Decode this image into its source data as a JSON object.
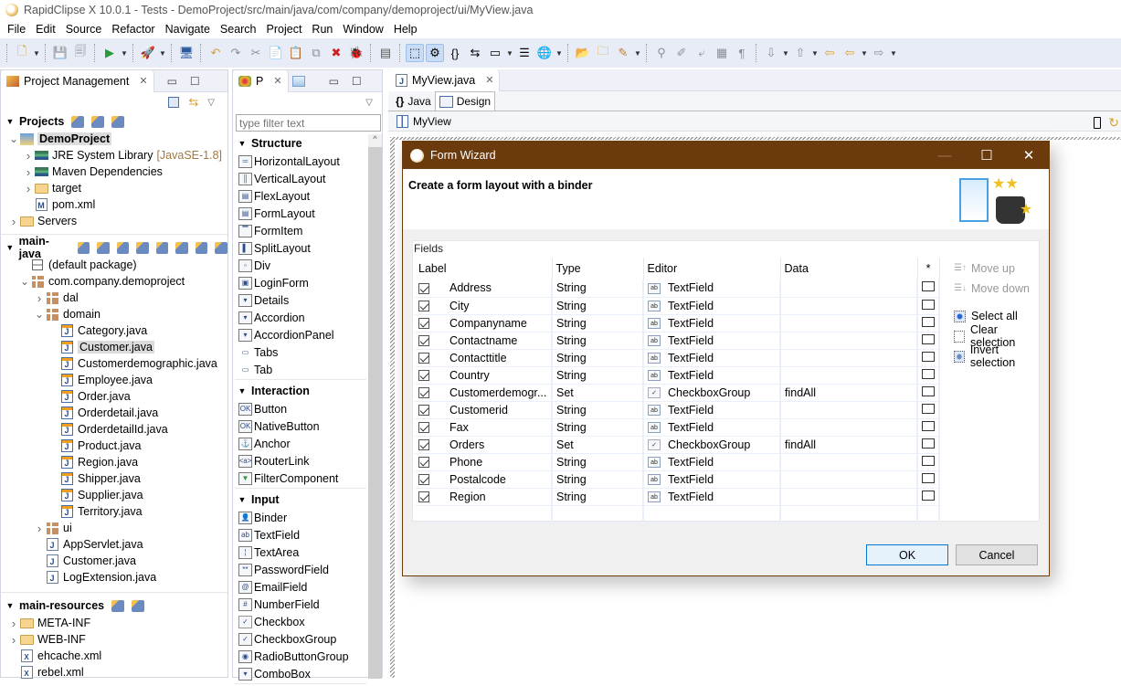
{
  "window": {
    "title": "RapidClipse X 10.0.1 - Tests - DemoProject/src/main/java/com/company/demoproject/ui/MyView.java"
  },
  "menu": [
    "File",
    "Edit",
    "Source",
    "Refactor",
    "Navigate",
    "Search",
    "Project",
    "Run",
    "Window",
    "Help"
  ],
  "toolbar": {
    "icons": [
      "new-icon",
      "save-icon",
      "save-all-icon",
      "run-server-icon",
      "deploy-icon",
      "preview-icon",
      "undo-icon",
      "redo-icon",
      "cut-icon",
      "copy-icon",
      "paste-icon",
      "duplicate-icon",
      "delete-icon",
      "debug-icon",
      "server-icon",
      "select-mode-icon",
      "design-mode-icon",
      "braces-icon",
      "tab-order-icon",
      "layout-icon",
      "properties-icon",
      "globe-icon",
      "open-project-icon",
      "open-folder-icon",
      "pen-icon",
      "search-icon",
      "highlighter-icon",
      "format-icon",
      "block-icon",
      "pilcrow-icon",
      "next-annotation-icon",
      "prev-annotation-icon",
      "last-edit-icon",
      "back-icon",
      "forward-icon"
    ]
  },
  "project_panel": {
    "tab_label": "Project Management",
    "projects_header": "Projects",
    "projects": [
      {
        "label": "DemoProject",
        "bold": true,
        "selected": true,
        "expanded": true,
        "indent": 0
      },
      {
        "label": "JRE System Library",
        "suffix": "[JavaSE-1.8]",
        "indent": 1,
        "icon": "library"
      },
      {
        "label": "Maven Dependencies",
        "indent": 1,
        "icon": "library"
      },
      {
        "label": "target",
        "indent": 1,
        "icon": "folder"
      },
      {
        "label": "pom.xml",
        "indent": 1,
        "icon": "maven"
      },
      {
        "label": "Servers",
        "indent": 0,
        "icon": "folder"
      }
    ],
    "main_java_header": "main-java",
    "main_java": [
      {
        "label": "(default package)",
        "indent": 0,
        "icon": "empty-package"
      },
      {
        "label": "com.company.demoproject",
        "indent": 0,
        "icon": "package",
        "expanded": true
      },
      {
        "label": "dal",
        "indent": 1,
        "icon": "package"
      },
      {
        "label": "domain",
        "indent": 1,
        "icon": "package",
        "expanded": true
      },
      {
        "label": "Category.java",
        "indent": 2,
        "icon": "entity"
      },
      {
        "label": "Customer.java",
        "indent": 2,
        "icon": "entity",
        "selected": true
      },
      {
        "label": "Customerdemographic.java",
        "indent": 2,
        "icon": "entity"
      },
      {
        "label": "Employee.java",
        "indent": 2,
        "icon": "entity"
      },
      {
        "label": "Order.java",
        "indent": 2,
        "icon": "entity"
      },
      {
        "label": "Orderdetail.java",
        "indent": 2,
        "icon": "entity"
      },
      {
        "label": "OrderdetailId.java",
        "indent": 2,
        "icon": "entity"
      },
      {
        "label": "Product.java",
        "indent": 2,
        "icon": "entity"
      },
      {
        "label": "Region.java",
        "indent": 2,
        "icon": "entity"
      },
      {
        "label": "Shipper.java",
        "indent": 2,
        "icon": "entity"
      },
      {
        "label": "Supplier.java",
        "indent": 2,
        "icon": "entity"
      },
      {
        "label": "Territory.java",
        "indent": 2,
        "icon": "entity"
      },
      {
        "label": "ui",
        "indent": 1,
        "icon": "package"
      },
      {
        "label": "AppServlet.java",
        "indent": 1,
        "icon": "java"
      },
      {
        "label": "Customer.java",
        "indent": 1,
        "icon": "java"
      },
      {
        "label": "LogExtension.java",
        "indent": 1,
        "icon": "java"
      }
    ],
    "main_resources_header": "main-resources",
    "main_resources": [
      {
        "label": "META-INF",
        "indent": 0,
        "icon": "folder"
      },
      {
        "label": "WEB-INF",
        "indent": 0,
        "icon": "folder"
      },
      {
        "label": "ehcache.xml",
        "indent": 0,
        "icon": "xml"
      },
      {
        "label": "rebel.xml",
        "indent": 0,
        "icon": "xml"
      }
    ]
  },
  "palette": {
    "tab_label": "P",
    "filter_placeholder": "type filter text",
    "sections": [
      {
        "title": "Structure",
        "items": [
          "HorizontalLayout",
          "VerticalLayout",
          "FlexLayout",
          "FormLayout",
          "FormItem",
          "SplitLayout",
          "Div",
          "LoginForm",
          "Details",
          "Accordion",
          "AccordionPanel",
          "Tabs",
          "Tab"
        ]
      },
      {
        "title": "Interaction",
        "items": [
          "Button",
          "NativeButton",
          "Anchor",
          "RouterLink",
          "FilterComponent"
        ]
      },
      {
        "title": "Input",
        "items": [
          "Binder",
          "TextField",
          "TextArea",
          "PasswordField",
          "EmailField",
          "NumberField",
          "Checkbox",
          "CheckboxGroup",
          "RadioButtonGroup",
          "ComboBox"
        ]
      }
    ]
  },
  "editor": {
    "file_tab": "MyView.java",
    "subtabs": [
      "Java",
      "Design"
    ],
    "active_subtab": "Design",
    "root_component": "MyView"
  },
  "dialog": {
    "title": "Form Wizard",
    "heading": "Create a form layout with a binder",
    "fields_label": "Fields",
    "columns": [
      "Label",
      "Type",
      "Editor",
      "Data",
      "*"
    ],
    "rows": [
      {
        "checked": true,
        "label": "Address",
        "type": "String",
        "editor": "TextField",
        "data": "",
        "required": false
      },
      {
        "checked": true,
        "label": "City",
        "type": "String",
        "editor": "TextField",
        "data": "",
        "required": false
      },
      {
        "checked": true,
        "label": "Companyname",
        "type": "String",
        "editor": "TextField",
        "data": "",
        "required": false
      },
      {
        "checked": true,
        "label": "Contactname",
        "type": "String",
        "editor": "TextField",
        "data": "",
        "required": false
      },
      {
        "checked": true,
        "label": "Contacttitle",
        "type": "String",
        "editor": "TextField",
        "data": "",
        "required": false
      },
      {
        "checked": true,
        "label": "Country",
        "type": "String",
        "editor": "TextField",
        "data": "",
        "required": false
      },
      {
        "checked": true,
        "label": "Customerdemogr...",
        "type": "Set",
        "editor": "CheckboxGroup",
        "data": "findAll",
        "required": false
      },
      {
        "checked": true,
        "label": "Customerid",
        "type": "String",
        "editor": "TextField",
        "data": "",
        "required": false
      },
      {
        "checked": true,
        "label": "Fax",
        "type": "String",
        "editor": "TextField",
        "data": "",
        "required": false
      },
      {
        "checked": true,
        "label": "Orders",
        "type": "Set",
        "editor": "CheckboxGroup",
        "data": "findAll",
        "required": false
      },
      {
        "checked": true,
        "label": "Phone",
        "type": "String",
        "editor": "TextField",
        "data": "",
        "required": false
      },
      {
        "checked": true,
        "label": "Postalcode",
        "type": "String",
        "editor": "TextField",
        "data": "",
        "required": false
      },
      {
        "checked": true,
        "label": "Region",
        "type": "String",
        "editor": "TextField",
        "data": "",
        "required": false
      }
    ],
    "side_buttons": {
      "move_up": "Move up",
      "move_down": "Move down",
      "select_all": "Select all",
      "clear_selection": "Clear selection",
      "invert_selection": "Invert selection"
    },
    "ok_label": "OK",
    "cancel_label": "Cancel",
    "colors": {
      "titlebar": "#6b3a0d",
      "ok_border": "#0078d7"
    }
  }
}
